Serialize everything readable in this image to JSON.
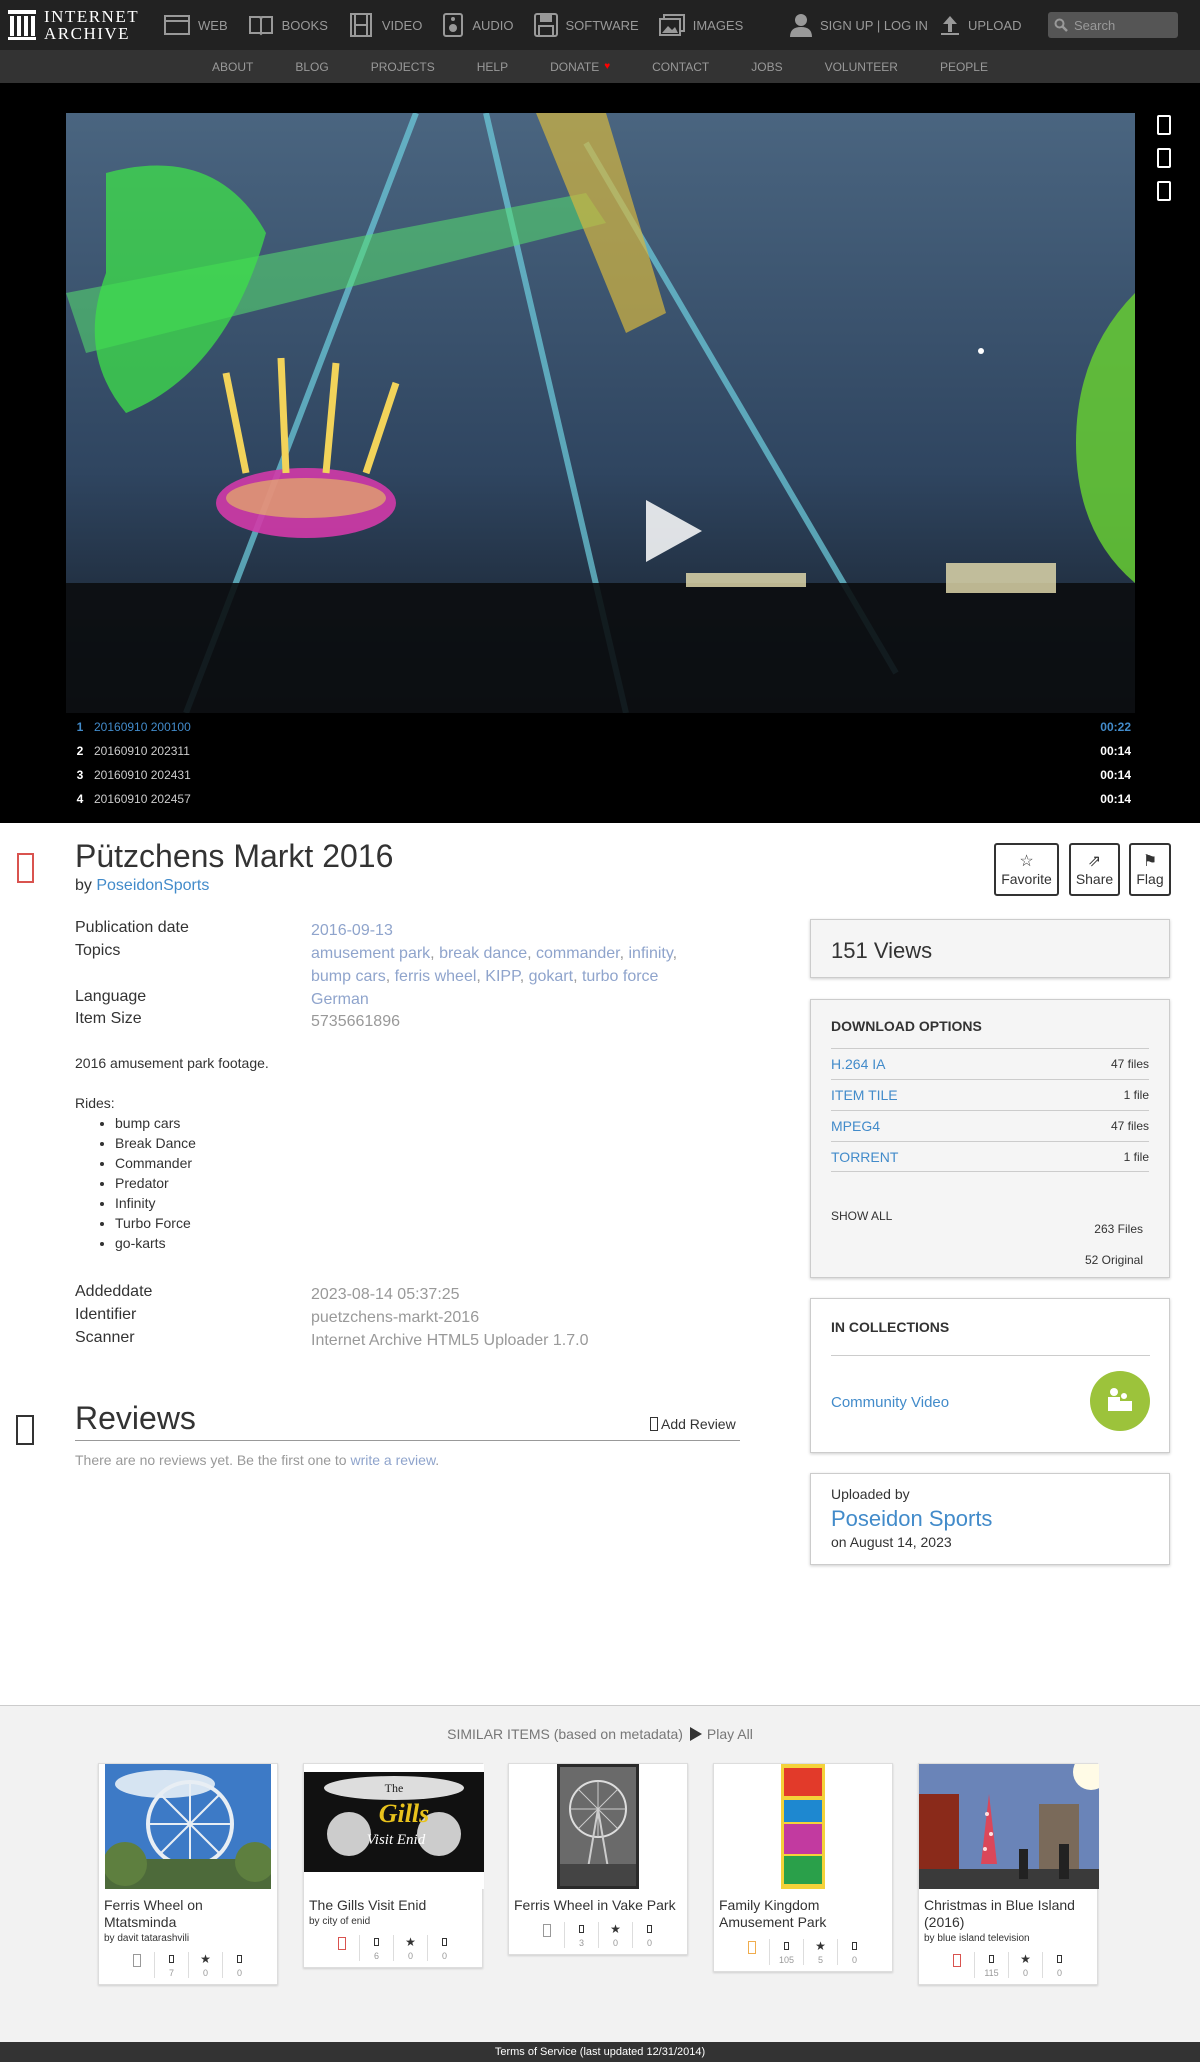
{
  "site": {
    "logo_line1": "INTERNET",
    "logo_line2": "ARCHIVE"
  },
  "media_tabs": [
    {
      "label": "WEB",
      "icon": "web-icon"
    },
    {
      "label": "BOOKS",
      "icon": "books-icon"
    },
    {
      "label": "VIDEO",
      "icon": "video-icon"
    },
    {
      "label": "AUDIO",
      "icon": "audio-icon"
    },
    {
      "label": "SOFTWARE",
      "icon": "software-icon"
    },
    {
      "label": "IMAGES",
      "icon": "images-icon"
    }
  ],
  "user": {
    "signup_label": "SIGN UP | LOG IN",
    "upload_label": "UPLOAD"
  },
  "search": {
    "placeholder": "Search"
  },
  "subnav": [
    "ABOUT",
    "BLOG",
    "PROJECTS",
    "HELP",
    "DONATE",
    "CONTACT",
    "JOBS",
    "VOLUNTEER",
    "PEOPLE"
  ],
  "playlist": [
    {
      "num": "1",
      "title": "20160910 200100",
      "duration": "00:22"
    },
    {
      "num": "2",
      "title": "20160910 202311",
      "duration": "00:14"
    },
    {
      "num": "3",
      "title": "20160910 202431",
      "duration": "00:14"
    },
    {
      "num": "4",
      "title": "20160910 202457",
      "duration": "00:14"
    }
  ],
  "item": {
    "title": "Pützchens Markt 2016",
    "by_prefix": "by",
    "creator": "PoseidonSports",
    "actions": {
      "favorite": "Favorite",
      "share": "Share",
      "flag": "Flag"
    },
    "metadata": {
      "pubdate_label": "Publication date",
      "pubdate_value": "2016-09-13",
      "topics_label": "Topics",
      "topics": [
        "amusement park",
        "break dance",
        "commander",
        "infinity",
        "bump cars",
        "ferris wheel",
        "KIPP",
        "gokart",
        "turbo force"
      ],
      "language_label": "Language",
      "language_value": "German",
      "size_label": "Item Size",
      "size_value": "5735661896"
    },
    "description": "2016 amusement park footage.",
    "rides_label": "Rides:",
    "rides": [
      "bump cars",
      "Break Dance",
      "Commander",
      "Predator",
      "Infinity",
      "Turbo Force",
      "go-karts"
    ],
    "extra": {
      "added_label": "Addeddate",
      "added_value": "2023-08-14 05:37:25",
      "identifier_label": "Identifier",
      "identifier_value": "puetzchens-markt-2016",
      "scanner_label": "Scanner",
      "scanner_value": "Internet Archive HTML5 Uploader 1.7.0"
    }
  },
  "reviews": {
    "title": "Reviews",
    "add_label": "Add Review",
    "empty_text": "There are no reviews yet. Be the first one to",
    "empty_link": "write a review",
    "empty_end": "."
  },
  "sidebar": {
    "views": "151 Views",
    "download_title": "DOWNLOAD OPTIONS",
    "downloads": [
      {
        "label": "H.264 IA",
        "count": "47 files"
      },
      {
        "label": "ITEM TILE",
        "count": "1 file"
      },
      {
        "label": "MPEG4",
        "count": "47 files"
      },
      {
        "label": "TORRENT",
        "count": "1 file"
      }
    ],
    "show_all": "SHOW ALL",
    "total_files": "263 Files",
    "original_files": "52 Original",
    "collections_title": "IN COLLECTIONS",
    "collection": "Community Video",
    "uploaded_by_label": "Uploaded by",
    "uploader": "Poseidon Sports",
    "upload_date": "on August 14, 2023"
  },
  "similar": {
    "heading": "SIMILAR ITEMS (based on metadata)",
    "play_all": "Play All",
    "items": [
      {
        "title": "Ferris Wheel on Mtatsminda",
        "by": "by davit tatarashvili",
        "views": "7",
        "favs": "0",
        "reviews": "0"
      },
      {
        "title": "The Gills Visit Enid",
        "by": "by city of enid",
        "views": "6",
        "favs": "0",
        "reviews": "0",
        "thumb_text1": "The",
        "thumb_text2": "Gills",
        "thumb_text3": "Visit Enid"
      },
      {
        "title": "Ferris Wheel in Vake Park",
        "by": "",
        "views": "3",
        "favs": "0",
        "reviews": "0"
      },
      {
        "title": "Family Kingdom Amusement Park",
        "by": "",
        "views": "105",
        "favs": "5",
        "reviews": "0"
      },
      {
        "title": "Christmas in Blue Island (2016)",
        "by": "by blue island television",
        "views": "115",
        "favs": "0",
        "reviews": "0"
      }
    ]
  },
  "footer": {
    "text": "Terms of Service (last updated 12/31/2014)"
  },
  "colors": {
    "accent": "#428bca",
    "nav_bg": "#222222",
    "collection_green": "#9cc33b"
  }
}
